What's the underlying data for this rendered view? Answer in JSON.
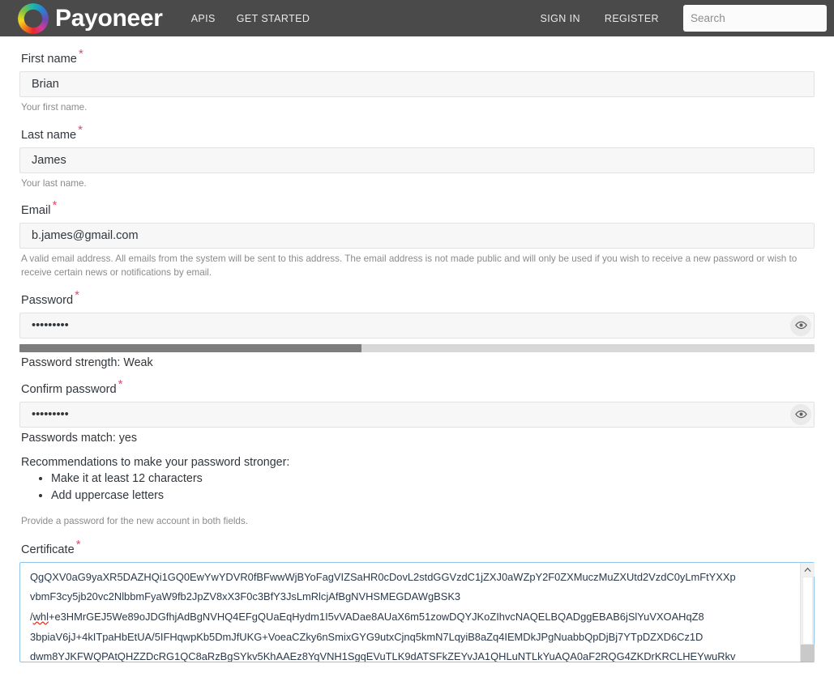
{
  "header": {
    "brand_name": "Payoneer",
    "logo_icon": "payoneer-ring-logo",
    "nav_links": [
      {
        "label": "APIS"
      },
      {
        "label": "GET STARTED"
      }
    ],
    "auth_links": [
      {
        "label": "SIGN IN"
      },
      {
        "label": "REGISTER"
      }
    ],
    "search": {
      "value": "",
      "placeholder": "Search"
    },
    "background_color": "#4a4a4a"
  },
  "form": {
    "required_marker": "*",
    "first_name": {
      "label": "First name",
      "value": "Brian",
      "placeholder": "",
      "help": "Your first name."
    },
    "last_name": {
      "label": "Last name",
      "value": "James",
      "placeholder": "",
      "help": "Your last name."
    },
    "email": {
      "label": "Email",
      "value": "b.james@gmail.com",
      "placeholder": "",
      "help": "A valid email address. All emails from the system will be sent to this address. The email address is not made public and will only be used if you wish to receive a new password or wish to receive certain news or notifications by email."
    },
    "password": {
      "label": "Password",
      "value": "•••••••••",
      "placeholder": "",
      "toggle_icon": "eye-icon",
      "strength_label": "Password strength: Weak",
      "strength_percent": 43,
      "strength_fill_color": "#7d7d7d",
      "strength_track_color": "#d8d8d8"
    },
    "confirm_password": {
      "label": "Confirm password",
      "value": "•••••••••",
      "placeholder": "",
      "toggle_icon": "eye-icon",
      "match_label": "Passwords match: yes"
    },
    "recommendations": {
      "title": "Recommendations to make your password stronger:",
      "items": [
        "Make it at least 12 characters",
        "Add uppercase letters"
      ]
    },
    "password_help": "Provide a password for the new account in both fields.",
    "certificate": {
      "label": "Certificate",
      "focus_border_color": "#8ec6f0",
      "scroll_up_icon": "chevron-up-icon",
      "lines": [
        {
          "pre": "QgQXV0aG9yaXR5DAZHQi1GQ0EwYwYDVR0fBFwwWjBYoFagVIZSaHR0cDovL2stdGGVzdC1jZXJ0aWZpY2F0ZXMuczMuZXUtd2VzdC0yLmFtYXXp",
          "misspell": "",
          "post": ""
        },
        {
          "pre": "vbmF3cy5jb20vc2NlbbmFyaW9fb2JpZV8xX3F0c3BfY3JsLmRlcjAfBgNVHSMEGDAWgBSK3",
          "misspell": "",
          "post": ""
        },
        {
          "pre": "/",
          "misspell": "whl",
          "post": "+e3HMrGEJ5We89oJDGfhjAdBgNVHQ4EFgQUaEqHydm1I5vVADae8AUaX6m51zowDQYJKoZIhvcNAQELBQADggEBAB6jSlYuVXOAHqZ8"
        },
        {
          "pre": "3bpiaV6jJ+4kITpaHbEtUA/5IFHqwpKb5DmJfUKG+VoeaCZky6nSmixGYG9utxCjnq5kmN7LqyiB8aZq4IEMDkJPgNuabbQpDjBj7YTpDZXD6Cz1D",
          "misspell": "",
          "post": ""
        },
        {
          "pre": "dwm8YJKFWQPAtQHZZDcRG1QC8aRzBgSYkv5KhAAEz8YqVNH1SgqEVuTLK9dATSFkZEYvJA1QHLuNTLkYuAQA0aF2RQG4ZKDrKRCLHEYwuRkv",
          "misspell": "",
          "post": ""
        }
      ]
    }
  }
}
